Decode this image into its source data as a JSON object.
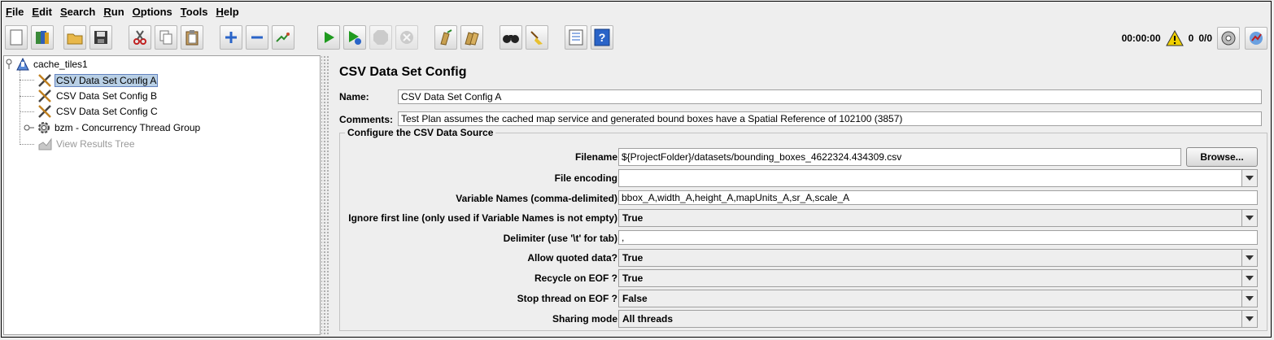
{
  "menu": [
    "File",
    "Edit",
    "Search",
    "Run",
    "Options",
    "Tools",
    "Help"
  ],
  "menu_mnemonics": [
    "F",
    "E",
    "S",
    "R",
    "O",
    "T",
    "H"
  ],
  "status": {
    "timer": "00:00:00",
    "warnings": "0",
    "threads": "0/0"
  },
  "tree": {
    "root": "cache_tiles1",
    "items": [
      {
        "label": "CSV Data Set Config A",
        "icon": "wrench-scissors-icon",
        "selected": true
      },
      {
        "label": "CSV Data Set Config B",
        "icon": "wrench-scissors-icon"
      },
      {
        "label": "CSV Data Set Config C",
        "icon": "wrench-scissors-icon"
      },
      {
        "label": "bzm - Concurrency Thread Group",
        "icon": "gear-icon"
      },
      {
        "label": "View Results Tree",
        "icon": "graph-icon",
        "disabled": true
      }
    ]
  },
  "panel": {
    "title": "CSV Data Set Config",
    "name_label": "Name:",
    "name_value": "CSV Data Set Config A",
    "comments_label": "Comments:",
    "comments_value": "Test Plan assumes the cached map service and generated bound boxes have a Spatial Reference of 102100 (3857)",
    "group_title": "Configure the CSV Data Source",
    "fields": {
      "filename_label": "Filename:",
      "filename_value": "${ProjectFolder}/datasets/bounding_boxes_4622324.434309.csv",
      "browse_label": "Browse...",
      "encoding_label": "File encoding:",
      "encoding_value": "",
      "varnames_label": "Variable Names (comma-delimited):",
      "varnames_value": "bbox_A,width_A,height_A,mapUnits_A,sr_A,scale_A",
      "ignore_label": "Ignore first line (only used if Variable Names is not empty):",
      "ignore_value": "True",
      "delimiter_label": "Delimiter (use '\\t' for tab):",
      "delimiter_value": ",",
      "quoted_label": "Allow quoted data?:",
      "quoted_value": "True",
      "recycle_label": "Recycle on EOF ?:",
      "recycle_value": "True",
      "stop_label": "Stop thread on EOF ?:",
      "stop_value": "False",
      "sharing_label": "Sharing mode:",
      "sharing_value": "All threads"
    }
  },
  "toolbar_icons": [
    "new-icon",
    "templates-icon",
    "open-icon",
    "save-icon",
    "cut-icon",
    "copy-icon",
    "paste-icon",
    "expand-icon",
    "collapse-icon",
    "toggle-icon",
    "start-icon",
    "start-no-pause-icon",
    "stop-icon",
    "shutdown-icon",
    "clear-icon",
    "clear-all-icon",
    "search-icon",
    "reset-search-icon",
    "function-helper-icon",
    "help-icon"
  ]
}
